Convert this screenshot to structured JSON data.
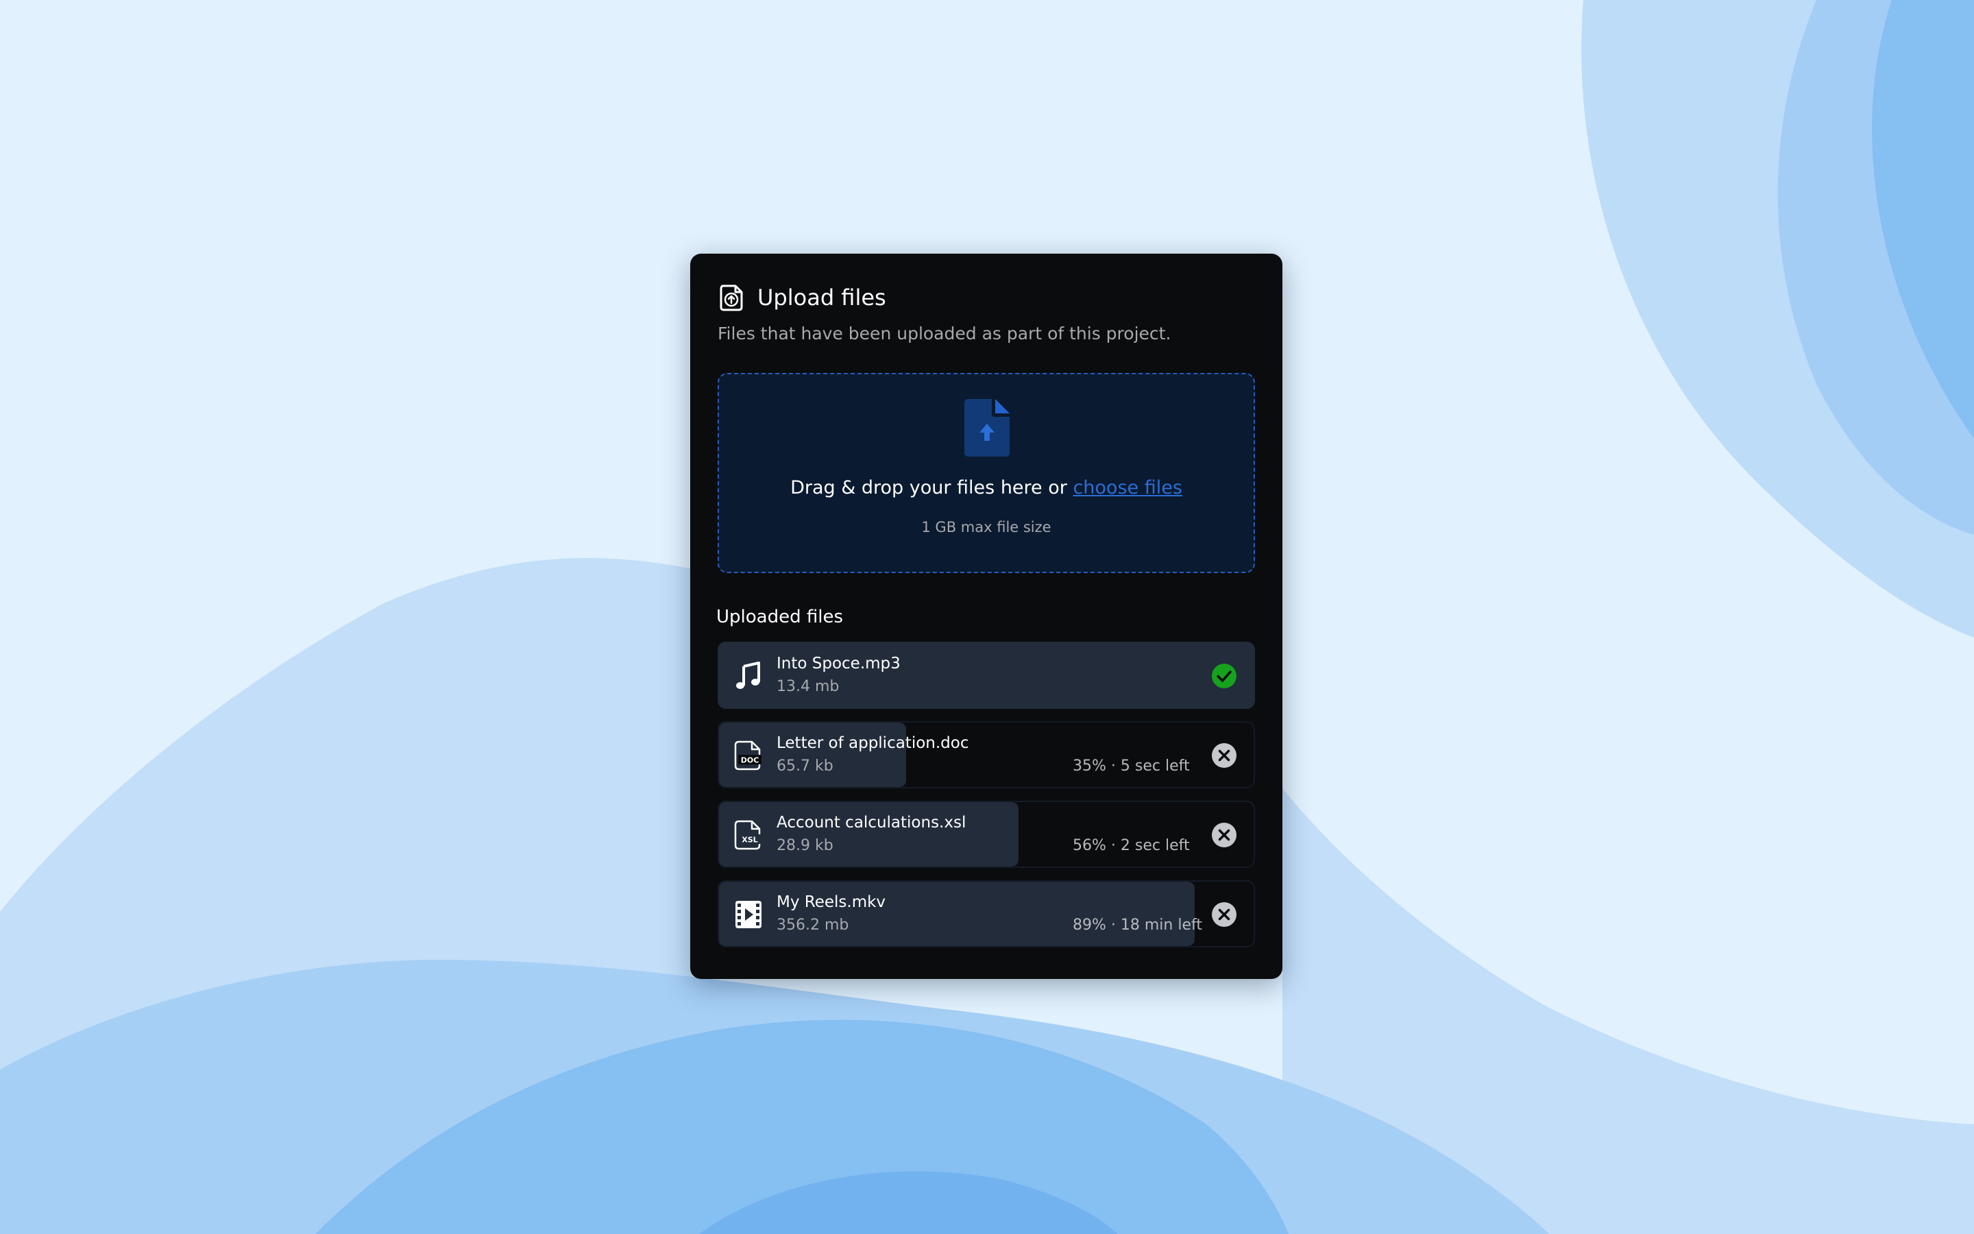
{
  "header": {
    "title": "Upload files",
    "subtitle": "Files that have been uploaded as part of this project."
  },
  "dropzone": {
    "text": "Drag & drop your files here or ",
    "link_label": "choose files",
    "hint": "1 GB max file size"
  },
  "uploaded": {
    "title": "Uploaded files",
    "files": [
      {
        "name": "Into Spoce.mp3",
        "size": "13.4 mb",
        "status": "",
        "progress": 100,
        "icon": "music-note-icon",
        "state": "complete"
      },
      {
        "name": "Letter of application.doc",
        "size": "65.7 kb",
        "status": "35% · 5 sec left",
        "progress": 35,
        "icon": "doc-file-icon",
        "state": "uploading"
      },
      {
        "name": "Account calculations.xsl",
        "size": "28.9 kb",
        "status": "56% · 2 sec left",
        "progress": 56,
        "icon": "xsl-file-icon",
        "state": "uploading"
      },
      {
        "name": "My Reels.mkv",
        "size": "356.2 mb",
        "status": "89% · 18 min left",
        "progress": 89,
        "icon": "video-file-icon",
        "state": "uploading"
      }
    ]
  },
  "colors": {
    "card_bg": "#0b0c0e",
    "row_fill": "#222c3b",
    "accent": "#2a6ed8",
    "success": "#16a21c",
    "cancel": "#c7c8cc"
  }
}
